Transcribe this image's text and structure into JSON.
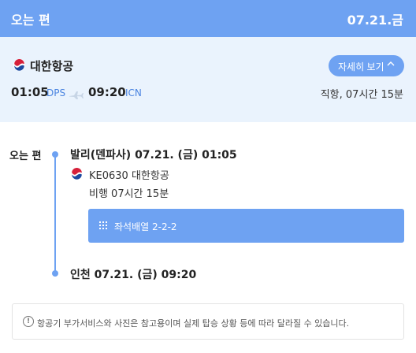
{
  "header": {
    "title": "오는 편",
    "date": "07.21.금"
  },
  "summary": {
    "airline": "대한항공",
    "detail_label": "자세히 보기",
    "departure": {
      "time": "01:05",
      "code": "DPS"
    },
    "arrival": {
      "time": "09:20",
      "code": "ICN"
    },
    "flight_info": "직항, 07시간 15분"
  },
  "itinerary": {
    "label": "오는 편",
    "departure": "발리(덴파사) 07.21. (금) 01:05",
    "segment": {
      "flight": "KE0630 대한항공",
      "duration": "비행 07시간 15분",
      "seat_label": "좌석배열 2-2-2"
    },
    "arrival": "인천 07.21. (금) 09:20"
  },
  "notice": {
    "text": "항공기 부가서비스와 사진은 참고용이며 실제 탑승 상황 등에 따라 달라질 수 있습니다."
  },
  "colors": {
    "accent": "#6ea2f2",
    "summary_bg": "#eaf3fd",
    "code_text": "#4a84e0"
  },
  "icons": {
    "airline_logo": "korean-air-logo-icon",
    "plane": "airplane-icon",
    "chevron": "chevron-up-icon",
    "seat": "seat-grid-icon",
    "info": "info-icon"
  }
}
